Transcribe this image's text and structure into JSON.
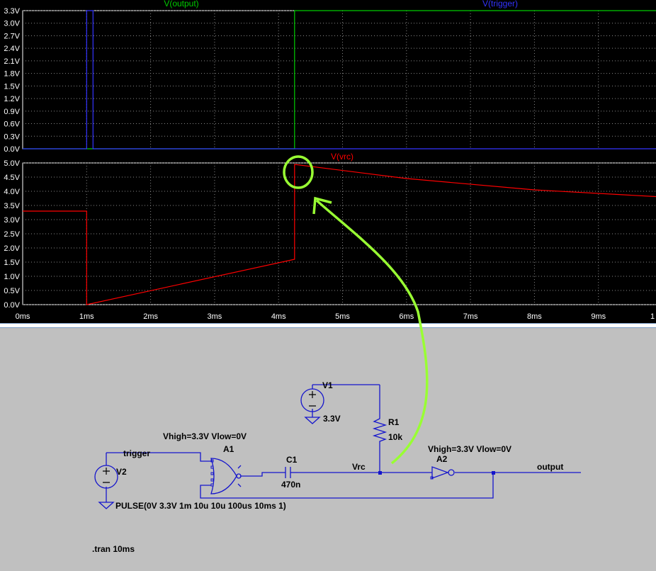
{
  "waveform_viewer": {
    "top_pane": {
      "traces": [
        {
          "label": "V(output)",
          "color": "#00cc00"
        },
        {
          "label": "V(trigger)",
          "color": "#3333ff"
        }
      ],
      "y_ticks": [
        "3.3V",
        "3.0V",
        "2.7V",
        "2.4V",
        "2.1V",
        "1.8V",
        "1.5V",
        "1.2V",
        "0.9V",
        "0.6V",
        "0.3V",
        "0.0V"
      ]
    },
    "bottom_pane": {
      "traces": [
        {
          "label": "V(vrc)",
          "color": "#ff0000"
        }
      ],
      "y_ticks": [
        "5.0V",
        "4.5V",
        "4.0V",
        "3.5V",
        "3.0V",
        "2.5V",
        "2.0V",
        "1.5V",
        "1.0V",
        "0.5V",
        "0.0V"
      ]
    },
    "x_ticks": [
      "0ms",
      "1ms",
      "2ms",
      "3ms",
      "4ms",
      "5ms",
      "6ms",
      "7ms",
      "8ms",
      "9ms",
      "1"
    ]
  },
  "schematic": {
    "labels": {
      "v1": "V1",
      "v1_value": "3.3V",
      "r1": "R1",
      "r1_value": "10k",
      "a1": "A1",
      "a1_params": "Vhigh=3.3V Vlow=0V",
      "a2": "A2",
      "a2_params": "Vhigh=3.3V Vlow=0V",
      "c1": "C1",
      "c1_value": "470n",
      "v2": "V2",
      "v2_value": "PULSE(0V 3.3V 1m 10u 10u 100us 10ms 1)",
      "net_trigger": "trigger",
      "net_vrc": "Vrc",
      "net_output": "output",
      "directive": ".tran 10ms"
    }
  },
  "chart_data": [
    {
      "type": "line",
      "xlabel": "",
      "ylabel": "",
      "xlim": [
        0,
        10
      ],
      "ylim": [
        0,
        3.3
      ],
      "series": [
        {
          "name": "V(output)",
          "x": [
            0,
            4.25,
            4.25,
            10
          ],
          "y": [
            0,
            0,
            3.3,
            3.3
          ]
        },
        {
          "name": "V(trigger)",
          "x": [
            0,
            1.0,
            1.0,
            1.1,
            1.1,
            10
          ],
          "y": [
            0,
            0,
            3.3,
            3.3,
            0,
            0
          ]
        }
      ]
    },
    {
      "type": "line",
      "xlabel": "",
      "ylabel": "",
      "xlim": [
        0,
        10
      ],
      "ylim": [
        0,
        5.0
      ],
      "series": [
        {
          "name": "V(vrc)",
          "x": [
            0,
            1.0,
            1.0,
            1.0,
            4.25,
            4.25,
            4.25,
            6,
            8,
            10
          ],
          "y": [
            3.3,
            3.3,
            1.7,
            0.0,
            1.6,
            1.6,
            4.95,
            4.45,
            4.05,
            3.8
          ]
        }
      ]
    }
  ]
}
